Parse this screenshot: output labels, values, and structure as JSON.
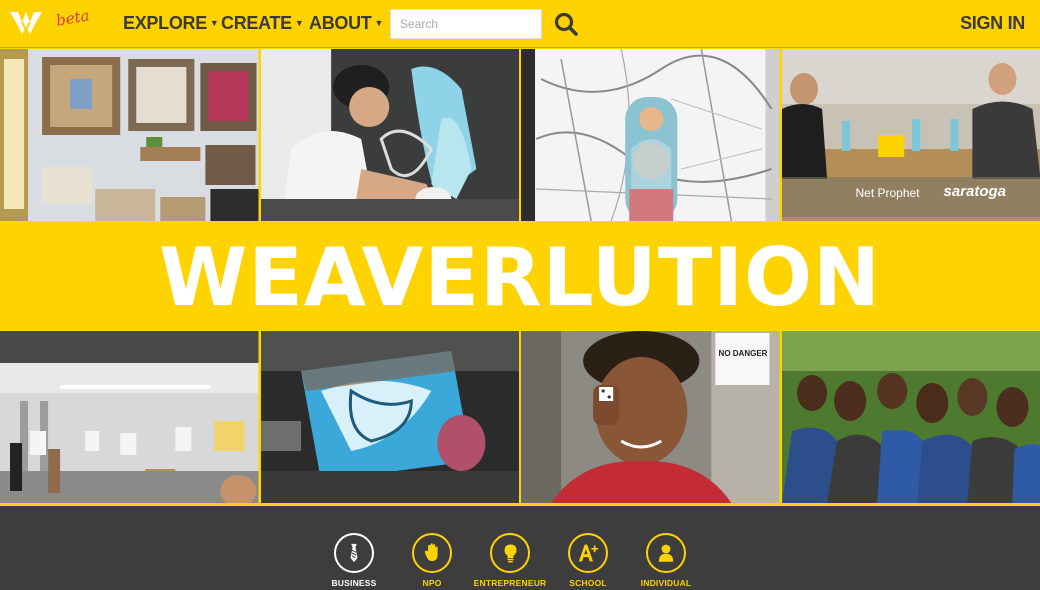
{
  "nav": {
    "logo_icon": "winged-shield-logo",
    "beta_label": "beta",
    "menu": [
      {
        "label": "EXPLORE",
        "has_dropdown": true
      },
      {
        "label": "CREATE",
        "has_dropdown": true
      },
      {
        "label": "ABOUT",
        "has_dropdown": true
      }
    ],
    "search": {
      "placeholder": "Search",
      "value": ""
    },
    "search_icon": "search-icon",
    "signin_label": "SIGN IN"
  },
  "banner": {
    "title": "WEAVERLUTION"
  },
  "photos_top": [
    {
      "description": "workshop-interior-with-crates-and-frames"
    },
    {
      "description": "artist-drawing-on-chalkboard"
    },
    {
      "description": "map-with-portrait-of-girl"
    },
    {
      "description": "people-at-table-net-prophet-saratoga",
      "overlay_text": [
        "Net Prophet",
        "saratoga"
      ]
    }
  ],
  "photos_bottom": [
    {
      "description": "exhibition-hall-with-visitors"
    },
    {
      "description": "painter-working-on-large-canvas"
    },
    {
      "description": "child-holding-dice",
      "overlay_text": "NO DANGER"
    },
    {
      "description": "group-of-school-girls"
    }
  ],
  "categories": [
    {
      "label": "BUSINESS",
      "icon": "tie-icon",
      "active": true
    },
    {
      "label": "NPO",
      "icon": "hand-icon",
      "active": false
    },
    {
      "label": "ENTREPRENEUR",
      "icon": "lightbulb-icon",
      "active": false
    },
    {
      "label": "SCHOOL",
      "icon": "a-plus-icon",
      "active": false
    },
    {
      "label": "INDIVIDUAL",
      "icon": "person-icon",
      "active": false
    }
  ],
  "colors": {
    "brand_yellow": "#ffd300",
    "nav_text": "#3a3a3a",
    "beta_red": "#e0383a",
    "footer_bg": "#3d3d3d",
    "banner_text": "#ffffff"
  }
}
